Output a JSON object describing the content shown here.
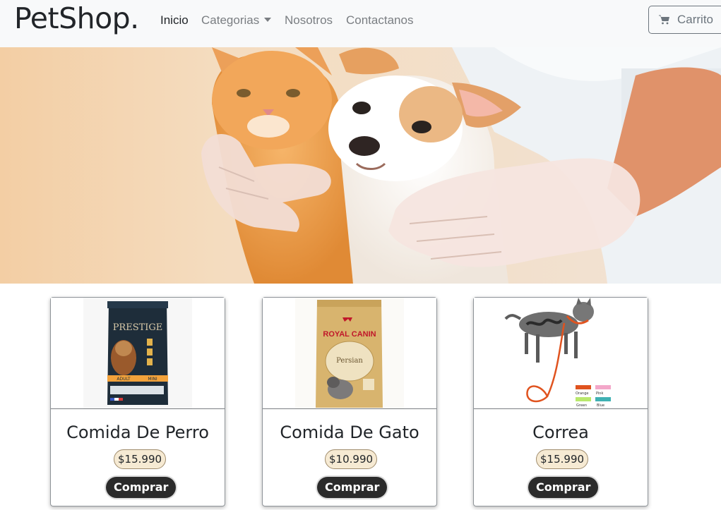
{
  "navbar": {
    "brand": "PetShop.",
    "links": [
      {
        "label": "Inicio",
        "active": true
      },
      {
        "label": "Categorias",
        "dropdown": true
      },
      {
        "label": "Nosotros"
      },
      {
        "label": "Contactanos"
      }
    ],
    "cart_label": "Carrito",
    "cart_icon": "cart-icon"
  },
  "hero": {
    "image": "kitten-and-puppy-held-by-gloved-hands"
  },
  "products": [
    {
      "title": "Comida De Perro",
      "price": "$15.990",
      "button": "Comprar",
      "image": "dog-food-bag",
      "bag_brand": "PRESTIGE",
      "bag_labels": [
        "ADULT",
        "MINI"
      ]
    },
    {
      "title": "Comida De Gato",
      "price": "$10.990",
      "button": "Comprar",
      "image": "cat-food-bag",
      "bag_brand": "ROYAL CANIN",
      "bag_sub": "Persian"
    },
    {
      "title": "Correa",
      "price": "$15.990",
      "button": "Comprar",
      "image": "cat-with-leash",
      "swatches": [
        "Orange",
        "Pink",
        "Green",
        "Blue"
      ]
    }
  ],
  "colors": {
    "navbar_bg": "#f8f9fa",
    "button_dark": "#2b2b2b",
    "price_badge": "#f6ead3"
  }
}
